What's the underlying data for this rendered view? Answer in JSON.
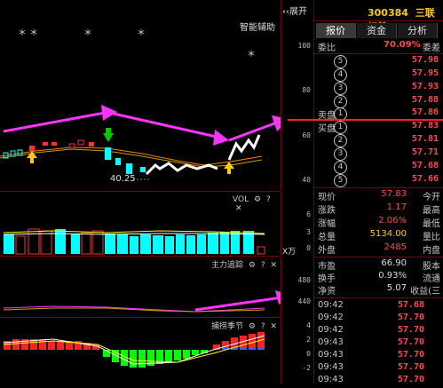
{
  "header": {
    "expand_label": "展开",
    "stock_code": "300384",
    "stock_name": "三联虹普"
  },
  "tabs": [
    {
      "label": "报价"
    },
    {
      "label": "资金"
    },
    {
      "label": "分析"
    }
  ],
  "assistant_label": "智能辅助",
  "stars": [
    "＊ ＊",
    "＊",
    "＊",
    "＊"
  ],
  "main_chart": {
    "yticks": [
      "100",
      "80",
      "60",
      "40"
    ],
    "low_label": "40.25"
  },
  "vol": {
    "title": "VOL",
    "yticks": [
      "6",
      "3",
      "0"
    ],
    "unit": "X万"
  },
  "zhuli": {
    "title": "主力追踪",
    "yticks": [
      "480",
      "440"
    ]
  },
  "bushou": {
    "title": "捕捞季节",
    "yticks": [
      "4",
      "2",
      "0",
      "-2"
    ]
  },
  "quote": {
    "weibi_label": "委比",
    "weibi_value": "70.09%",
    "weicha_label": "委差",
    "sell": [
      {
        "n": "5",
        "price": "57.98"
      },
      {
        "n": "4",
        "price": "57.95"
      },
      {
        "n": "3",
        "price": "57.93"
      },
      {
        "n": "2",
        "price": "57.88"
      },
      {
        "n": "1",
        "price": "57.86"
      }
    ],
    "sell_label": "卖盘",
    "buy_label": "买盘",
    "buy": [
      {
        "n": "1",
        "price": "57.83"
      },
      {
        "n": "2",
        "price": "57.81"
      },
      {
        "n": "3",
        "price": "57.71"
      },
      {
        "n": "4",
        "price": "57.68"
      },
      {
        "n": "5",
        "price": "57.66"
      }
    ],
    "stats": [
      {
        "label": "现价",
        "value": "57.83",
        "extra": "今开"
      },
      {
        "label": "涨跌",
        "value": "1.17",
        "extra": "最高"
      },
      {
        "label": "涨幅",
        "value": "2.06%",
        "extra": "最低"
      },
      {
        "label": "总量",
        "value": "5134.00",
        "extra": "量比"
      },
      {
        "label": "外盘",
        "value": "2485",
        "extra": "内盘"
      }
    ],
    "stats2": [
      {
        "label": "市盈",
        "value": "66.90",
        "extra": "股本"
      },
      {
        "label": "换手",
        "value": "0.93%",
        "extra": "流通"
      },
      {
        "label": "净资",
        "value": "5.07",
        "extra": "收益(三"
      }
    ],
    "ticks": [
      {
        "time": "09:42",
        "price": "57.68"
      },
      {
        "time": "09:42",
        "price": "57.70"
      },
      {
        "time": "09:42",
        "price": "57.70"
      },
      {
        "time": "09:43",
        "price": "57.70"
      },
      {
        "time": "09:43",
        "price": "57.70"
      },
      {
        "time": "09:43",
        "price": "57.70"
      },
      {
        "time": "09:43",
        "price": "57.70"
      }
    ]
  },
  "colors": {
    "up": "#ff3030",
    "down": "#00ffff",
    "grid": "#7a0000",
    "arrow": "#ff33ff"
  }
}
